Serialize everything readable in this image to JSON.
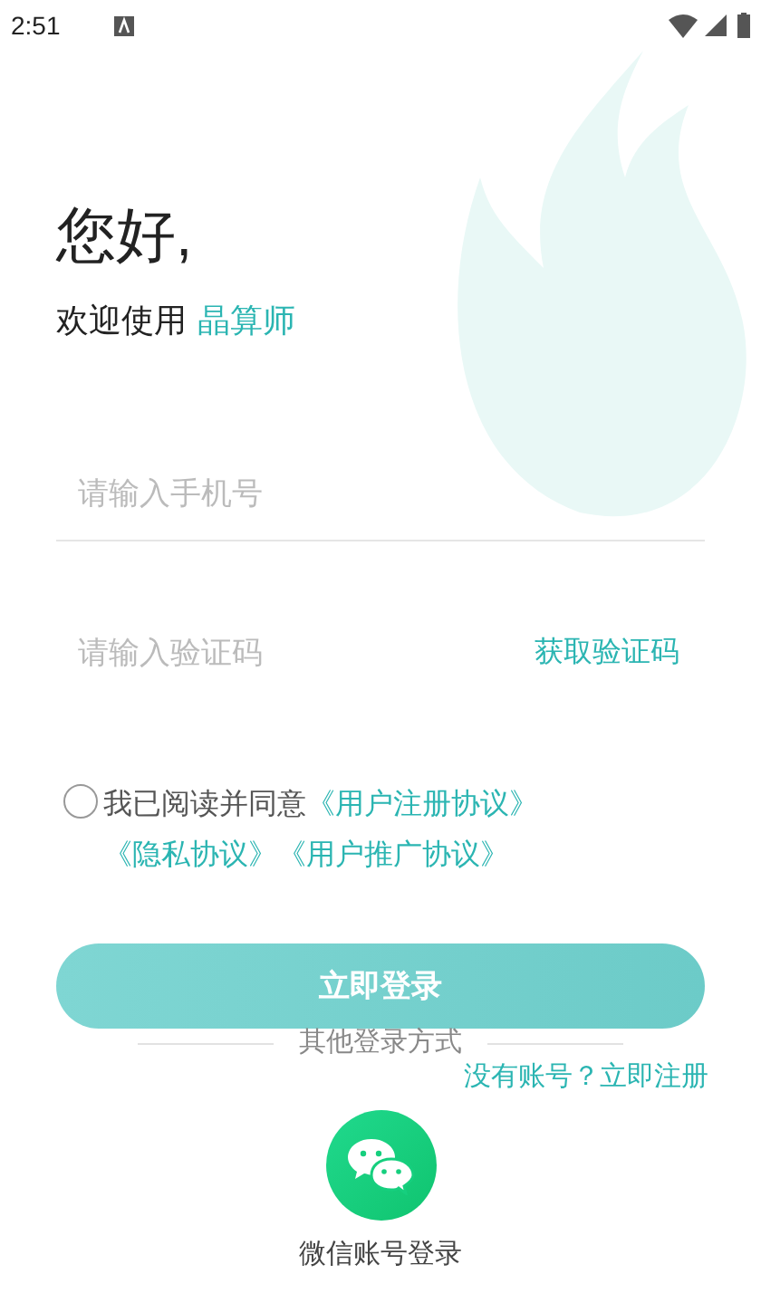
{
  "status_bar": {
    "time": "2:51"
  },
  "greeting": "您好,",
  "welcome": {
    "text": "欢迎使用",
    "app_name": "晶算师"
  },
  "phone_field": {
    "placeholder": "请输入手机号"
  },
  "code_field": {
    "placeholder": "请输入验证码",
    "action": "获取验证码"
  },
  "agreement": {
    "checked": false,
    "prefix": "我已阅读并同意",
    "links": [
      "《用户注册协议》",
      "《隐私协议》",
      "《用户推广协议》"
    ]
  },
  "login_button": {
    "label": "立即登录",
    "disabled": true
  },
  "other_login": "其他登录方式",
  "register_link": "没有账号？立即注册",
  "wechat_login": {
    "label": "微信账号登录"
  }
}
